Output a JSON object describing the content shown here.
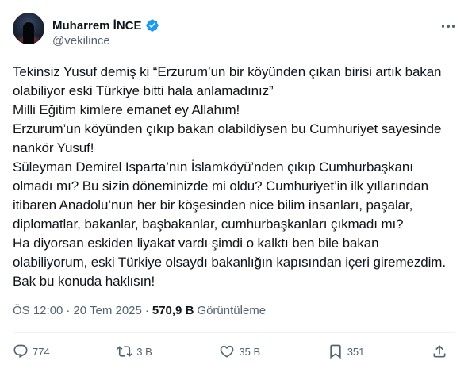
{
  "author": {
    "display_name": "Muharrem İNCE",
    "handle": "@vekilince"
  },
  "tweet": {
    "lines": [
      "Tekinsiz Yusuf demiş ki “Erzurum’un bir köyünden çıkan birisi artık bakan",
      "olabiliyor eski Türkiye bitti hala anlamadınız”",
      "Milli Eğitim kimlere emanet ey Allahım!",
      "Erzurum’un köyünden çıkıp bakan olabildiysen bu Cumhuriyet sayesinde",
      "nankör Yusuf!",
      "Süleyman Demirel Isparta’nın İslamköyü’nden çıkıp Cumhurbaşkanı",
      "olmadı mı? Bu sizin döneminizde mi oldu? Cumhuriyet’in ilk yıllarından",
      "itibaren Anadolu’nun her bir köşesinden nice bilim insanları, paşalar,",
      "diplomatlar, bakanlar, başbakanlar, cumhurbaşkanları çıkmadı mı?",
      "Ha diyorsan eskiden liyakat vardı şimdi o kalktı ben bile bakan",
      "olabiliyorum, eski Türkiye olsaydı bakanlığın kapısından içeri giremezdim.",
      "Bak bu konuda haklısın!"
    ]
  },
  "meta": {
    "time": "ÖS 12:00",
    "separator": "·",
    "date": "20 Tem 2025",
    "views_count": "570,9 B",
    "views_label": "Görüntüleme"
  },
  "actions": {
    "replies": "774",
    "reposts": "3 B",
    "likes": "35 B",
    "bookmarks": "351"
  },
  "colors": {
    "text": "#0f1419",
    "secondary": "#536471",
    "verified": "#1d9bf0"
  }
}
